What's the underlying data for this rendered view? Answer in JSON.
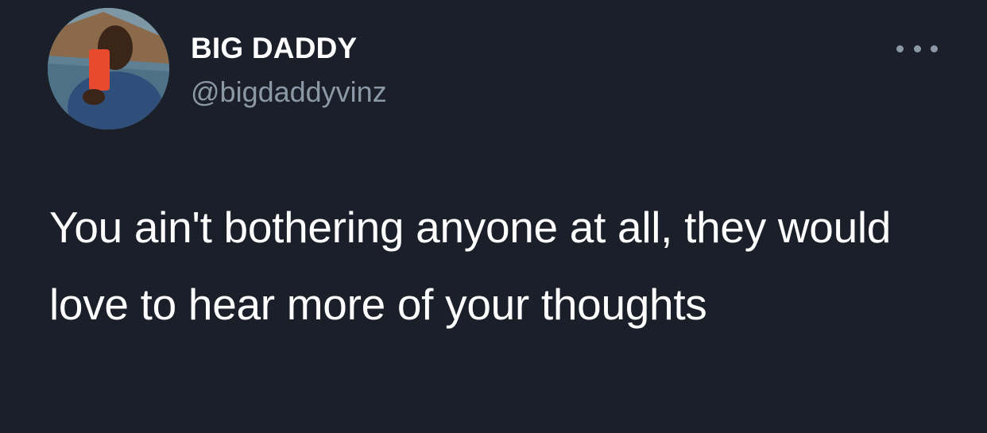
{
  "author": {
    "display_name": "BIG DADDY",
    "handle": "@bigdaddyvinz",
    "avatar_icon": "profile-photo"
  },
  "tweet": {
    "text": "You ain't bothering anyone at all, they would love to hear more of your thoughts"
  },
  "actions": {
    "more_icon": "ellipsis-icon"
  },
  "colors": {
    "background": "#1b1f29",
    "text_primary": "#ffffff",
    "text_secondary": "#8b98a5"
  }
}
